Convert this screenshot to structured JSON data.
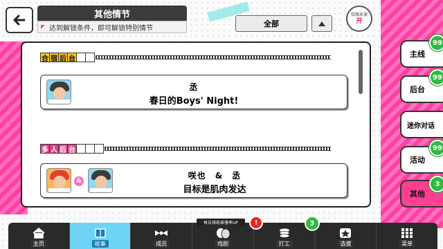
{
  "header": {
    "title": "其他情节",
    "subtitle": "达到解锁条件，即可解锁特别情节",
    "filter_value": "全部",
    "limited_label": "仅限未读",
    "limited_state": "开"
  },
  "sections": [
    {
      "header_chars": [
        "合",
        "宿",
        "后",
        "台",
        "",
        ""
      ],
      "header_color": "#f5c518",
      "filled_count": 4,
      "card": {
        "characters": "丞",
        "title": "春日的Boys' Night!"
      }
    },
    {
      "header_chars": [
        "多",
        "人",
        "后",
        "台",
        "",
        "",
        ""
      ],
      "header_color": "#e53f8c",
      "filled_count": 4,
      "card": {
        "characters": "咲也　&　丞",
        "title": "目标是肌肉发达",
        "amp": "&"
      }
    }
  ],
  "side_tabs": [
    {
      "label": "主线",
      "badge": "99"
    },
    {
      "label": "后台",
      "badge": "99"
    },
    {
      "label": "迷你对话",
      "badge": ""
    },
    {
      "label": "活动",
      "badge": "99"
    },
    {
      "label": "其他",
      "badge": "3"
    }
  ],
  "bottom_nav": [
    {
      "label": "主页",
      "icon": "home-icon"
    },
    {
      "label": "故事",
      "icon": "book-icon"
    },
    {
      "label": "成员",
      "icon": "members-icon"
    },
    {
      "label": "戏剧",
      "icon": "mask-icon"
    },
    {
      "label": "打工",
      "icon": "coins-icon"
    },
    {
      "label": "选拔",
      "icon": "star-icon"
    },
    {
      "label": "菜单",
      "icon": "grid-icon"
    }
  ],
  "nav_extras": {
    "event_banner": "每日排练掉落率UP",
    "alert_mark": "!",
    "work_badge": "3"
  },
  "colors": {
    "accent_pink": "#ff3f8f",
    "active_blue": "#6fd3f5",
    "badge_green": "#2fbb3f"
  }
}
